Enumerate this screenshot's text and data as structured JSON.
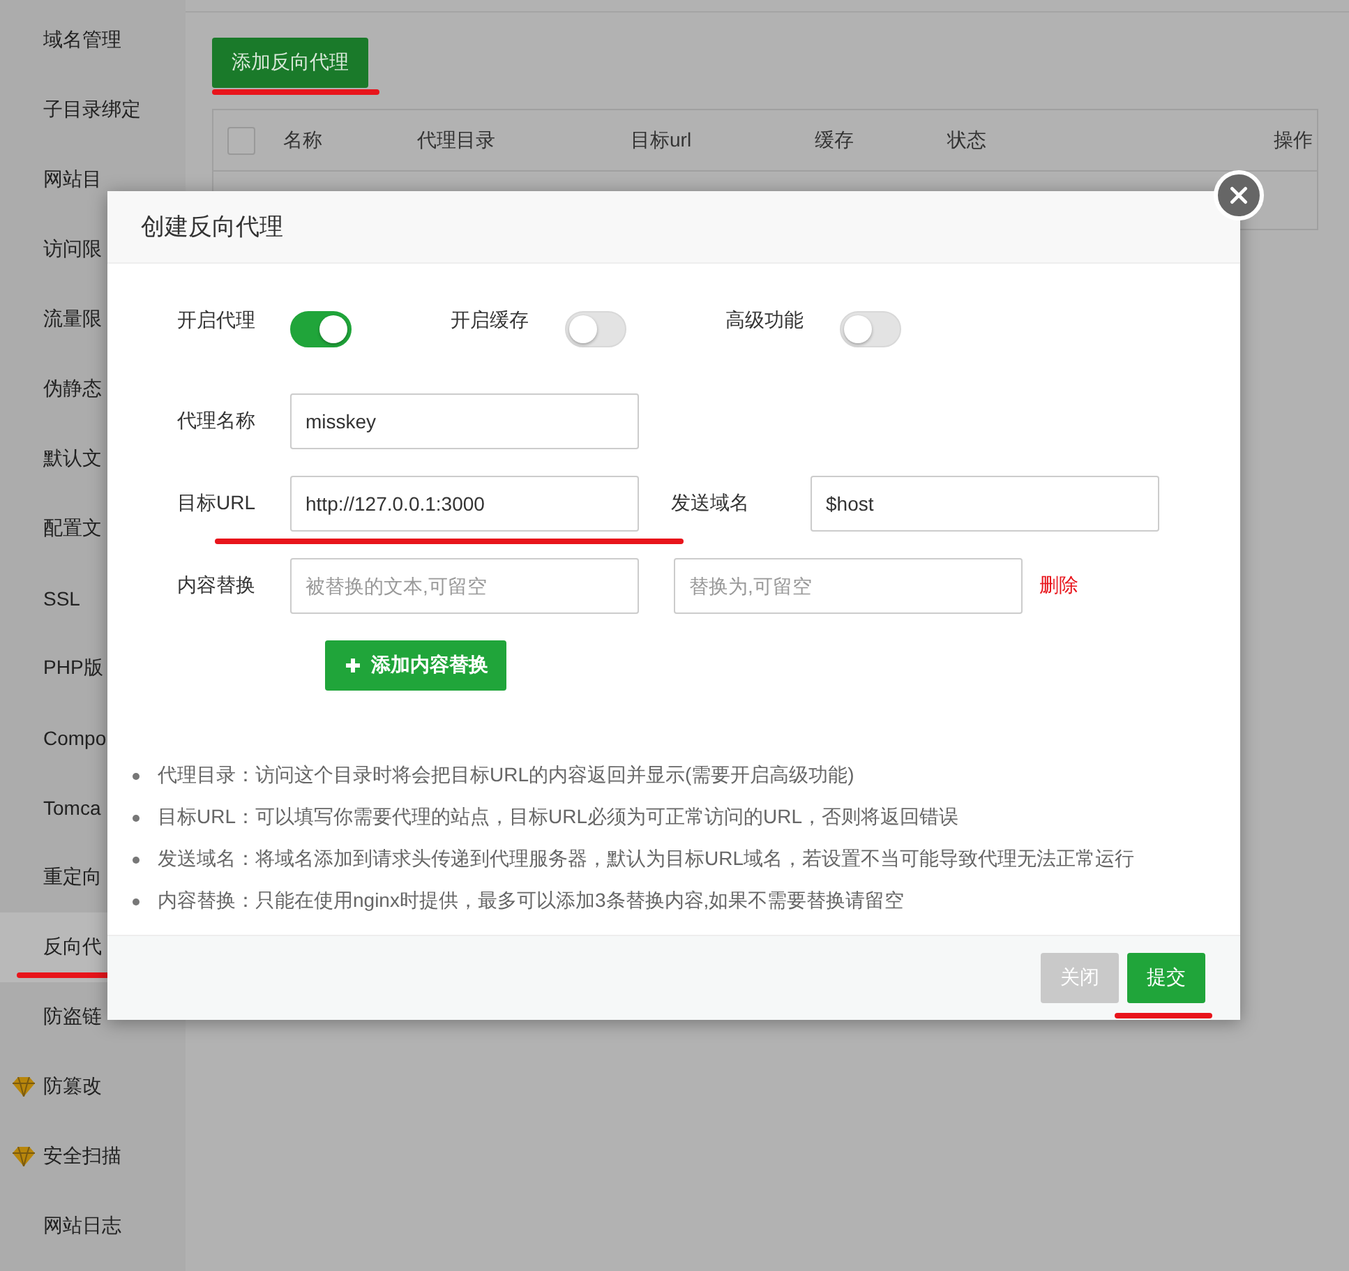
{
  "sidebar": {
    "items": [
      {
        "label": "域名管理",
        "selected": false,
        "premium": false,
        "underlined": false
      },
      {
        "label": "子目录绑定",
        "selected": false,
        "premium": false,
        "underlined": false
      },
      {
        "label": "网站目",
        "selected": false,
        "premium": false,
        "underlined": false
      },
      {
        "label": "访问限",
        "selected": false,
        "premium": false,
        "underlined": false
      },
      {
        "label": "流量限",
        "selected": false,
        "premium": false,
        "underlined": false
      },
      {
        "label": "伪静态",
        "selected": false,
        "premium": false,
        "underlined": false
      },
      {
        "label": "默认文",
        "selected": false,
        "premium": false,
        "underlined": false
      },
      {
        "label": "配置文",
        "selected": false,
        "premium": false,
        "underlined": false
      },
      {
        "label": "SSL",
        "selected": false,
        "premium": false,
        "underlined": false
      },
      {
        "label": "PHP版",
        "selected": false,
        "premium": false,
        "underlined": false
      },
      {
        "label": "Compo",
        "selected": false,
        "premium": false,
        "underlined": false
      },
      {
        "label": "Tomca",
        "selected": false,
        "premium": false,
        "underlined": false
      },
      {
        "label": "重定向",
        "selected": false,
        "premium": false,
        "underlined": false
      },
      {
        "label": "反向代",
        "selected": true,
        "premium": false,
        "underlined": true
      },
      {
        "label": "防盗链",
        "selected": false,
        "premium": false,
        "underlined": false
      },
      {
        "label": "防篡改",
        "selected": false,
        "premium": true,
        "underlined": false
      },
      {
        "label": "安全扫描",
        "selected": false,
        "premium": true,
        "underlined": false
      },
      {
        "label": "网站日志",
        "selected": false,
        "premium": false,
        "underlined": false
      }
    ]
  },
  "main": {
    "add_button": {
      "label": "添加反向代理",
      "underlined": true
    },
    "table": {
      "columns": [
        "名称",
        "代理目录",
        "目标url",
        "缓存",
        "状态",
        "操作"
      ],
      "select_all_checked": false
    }
  },
  "modal": {
    "title": "创建反向代理",
    "switches": [
      {
        "label": "开启代理",
        "on": true
      },
      {
        "label": "开启缓存",
        "on": false
      },
      {
        "label": "高级功能",
        "on": false
      }
    ],
    "rows": [
      {
        "label": "代理名称",
        "field": {
          "value": "misskey"
        },
        "underlined": false
      },
      {
        "label": "目标URL",
        "field": {
          "value": "http://127.0.0.1:3000"
        },
        "underlined": true,
        "second": {
          "label": "发送域名",
          "field": {
            "value": "$host"
          }
        }
      },
      {
        "label": "内容替换",
        "field": {
          "placeholder": "被替换的文本,可留空"
        },
        "underlined": false,
        "second": {
          "field": {
            "placeholder": "替换为,可留空"
          }
        },
        "delete_link": "删除"
      }
    ],
    "add_replace_button": "添加内容替换",
    "notes": [
      "代理目录：访问这个目录时将会把目标URL的内容返回并显示(需要开启高级功能)",
      "目标URL：可以填写你需要代理的站点，目标URL必须为可正常访问的URL，否则将返回错误",
      "发送域名：将域名添加到请求头传递到代理服务器，默认为目标URL域名，若设置不当可能导致代理无法正常运行",
      "内容替换：只能在使用nginx时提供，最多可以添加3条替换内容,如果不需要替换请留空"
    ],
    "buttons": [
      {
        "label": "关闭",
        "kind": "secondary",
        "underlined": false
      },
      {
        "label": "提交",
        "kind": "primary",
        "underlined": true
      }
    ]
  }
}
